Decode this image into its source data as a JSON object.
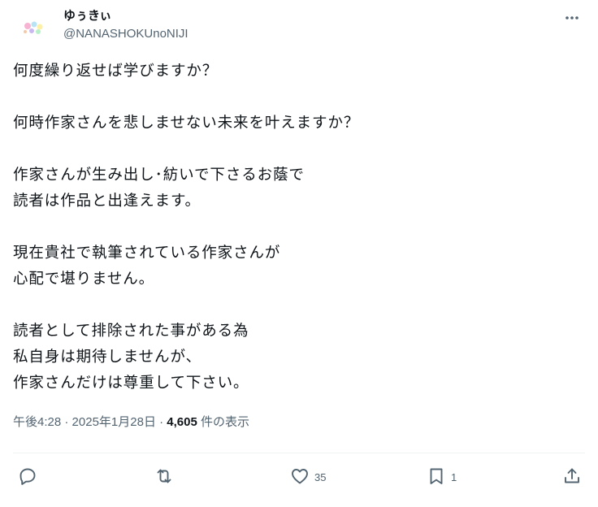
{
  "user": {
    "display_name": "ゆぅきぃ",
    "handle": "@NANASHOKUnoNIJI"
  },
  "post": {
    "lines": [
      "何度繰り返せば学びますか？",
      "",
      "何時作家さんを悲しませない未来を叶えますか？",
      "",
      "作家さんが生み出し･紡いで下さるお蔭で",
      "読者は作品と出逢えます。",
      "",
      "現在貴社で執筆されている作家さんが",
      "心配で堪りません。",
      "",
      "読者として排除された事がある為",
      "私自身は期待しませんが、",
      "作家さんだけは尊重して下さい。"
    ]
  },
  "meta": {
    "time": "午後4:28",
    "sep1": " · ",
    "date": "2025年1月28日",
    "sep2": " · ",
    "views": "4,605",
    "views_label": " 件の表示"
  },
  "actions": {
    "reply_count": "",
    "repost_count": "",
    "like_count": "35",
    "bookmark_count": "1"
  },
  "icons": {
    "more": "more-horizontal-icon",
    "reply": "reply-icon",
    "repost": "repost-icon",
    "like": "heart-icon",
    "bookmark": "bookmark-icon",
    "share": "share-icon"
  },
  "colors": {
    "text": "#0f1419",
    "secondary": "#536471",
    "divider": "#eff3f4"
  }
}
